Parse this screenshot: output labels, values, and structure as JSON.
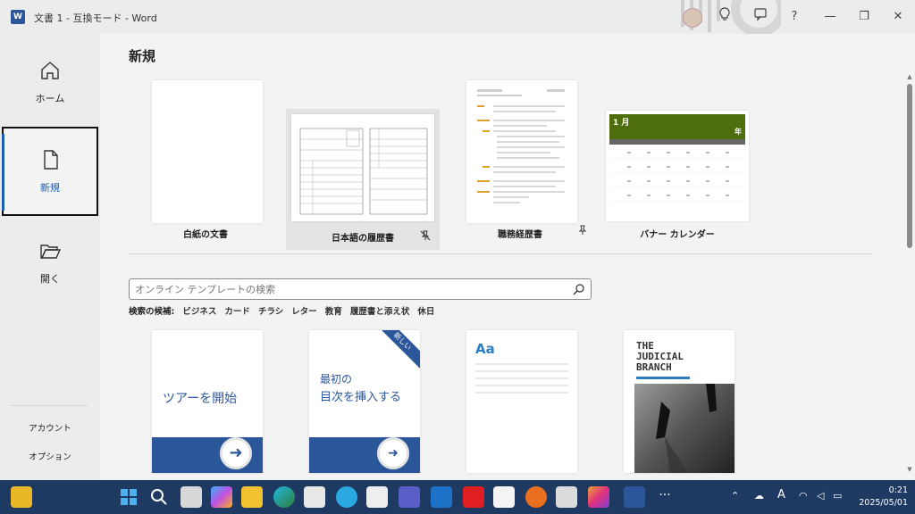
{
  "window": {
    "title": "文書 1  -  互換モード  -  Word",
    "app_icon": "W",
    "avatar": "user-avatar",
    "buttons": {
      "lightbulb": "lightbulb-icon",
      "feedback": "feedback-icon",
      "help": "?",
      "minimize": "—",
      "restore": "❐",
      "close": "✕"
    }
  },
  "sidebar": {
    "items": [
      {
        "label": "ホーム",
        "icon": "home-icon"
      },
      {
        "label": "新規",
        "icon": "new-document-icon",
        "active": true
      },
      {
        "label": "開く",
        "icon": "folder-open-icon"
      }
    ],
    "account": "アカウント",
    "options": "オプション"
  },
  "main": {
    "heading": "新規",
    "templates": [
      {
        "caption": "白紙の文書"
      },
      {
        "caption": "日本語の履歴書",
        "pinned": true
      },
      {
        "caption": "職務経歴書",
        "pin": "pin-icon"
      },
      {
        "caption": "バナー カレンダー",
        "month": "1 月",
        "year": "年"
      }
    ],
    "search": {
      "placeholder": "オンライン テンプレートの検索",
      "suggest_label": "検索の候補:",
      "suggestions": [
        "ビジネス",
        "カード",
        "チラシ",
        "レター",
        "教育",
        "履歴書と添え状",
        "休日"
      ]
    },
    "online": [
      {
        "text": "ツアーを開始"
      },
      {
        "text_line1": "最初の",
        "text_line2": "目次を挿入する",
        "badge": "新しい"
      },
      {
        "text": "Aa"
      },
      {
        "line1": "THE",
        "line2": "JUDICIAL",
        "line3": "BRANCH"
      }
    ]
  },
  "taskbar": {
    "time": "0:21",
    "date": "2025/05/01",
    "ime": "A"
  },
  "colors": {
    "accent": "#1a5fb4",
    "taskbar": "#1f3a62",
    "word_blue": "#2b579a"
  }
}
